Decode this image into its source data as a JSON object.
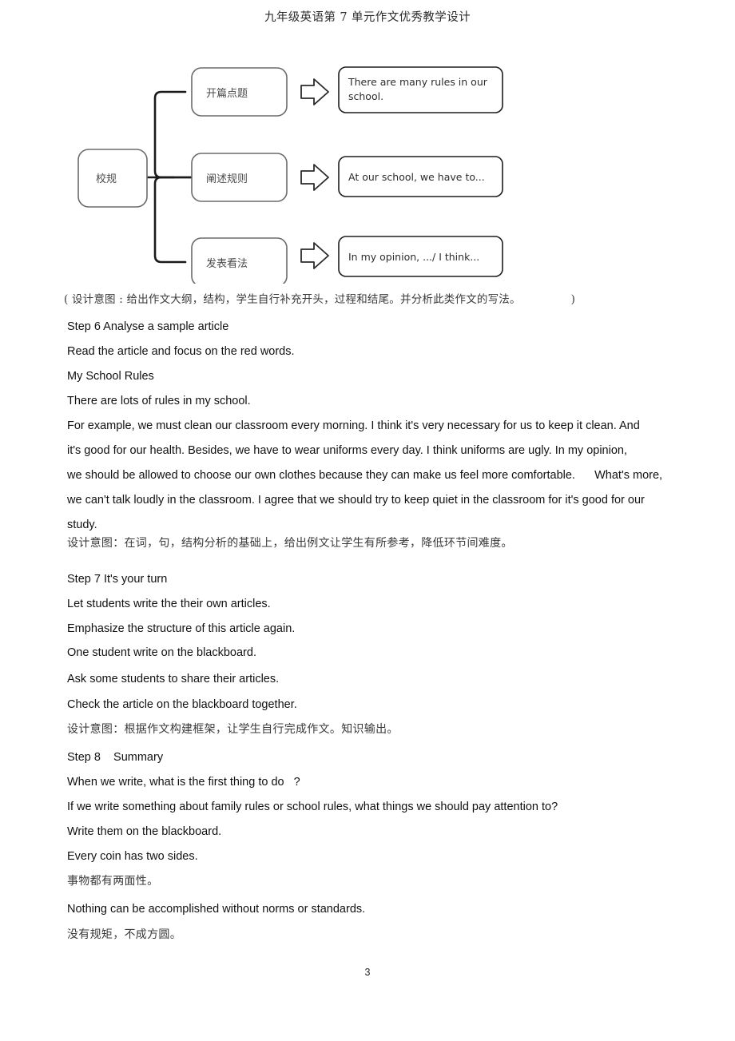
{
  "header": {
    "title": "九年级英语第 7 单元作文优秀教学设计"
  },
  "diagram": {
    "root_node": "校规",
    "branches": [
      {
        "stage": "开篇点题",
        "phrase_line1": "There are many rules in our",
        "phrase_line2": "school."
      },
      {
        "stage": "阐述规则",
        "phrase_line1": "At our school, we have to...",
        "phrase_line2": ""
      },
      {
        "stage": "发表看法",
        "phrase_line1": "In my opinion, .../ I think...",
        "phrase_line2": ""
      }
    ],
    "arrow_icon": "right-block-arrow"
  },
  "diagram_caption": "( 设计意图 : 给出作文大纲，结构，学生自行补充开头，过程和结尾。并分析此类作文的写法。              )",
  "step6": {
    "heading": "Step 6 Analyse a sample article",
    "instruction": "Read the article and focus on the red words.",
    "article_title": "My School Rules",
    "article_lead": "There are lots of rules in my school.",
    "article_lines": [
      "For example, we must clean our classroom every morning. I think it's very necessary for us to keep it clean. And",
      "it's good for our health. Besides, we have to wear uniforms every day. I think uniforms are ugly. In my opinion,",
      "we should be allowed to choose our own clothes because they can make us feel more comfortable.      What's more,",
      "we can't talk loudly in the classroom. I agree that we should try to keep quiet in the classroom for it's good for our",
      "study."
    ],
    "intent": "设计意图：在词，句，结构分析的基础上，给出例文让学生有所参考，降低环节间难度。"
  },
  "step7": {
    "heading": "Step 7 It's your turn",
    "lines": [
      "Let students write the their own articles.",
      "Emphasize the structure of this article again.",
      "One student write on the blackboard.",
      "Ask some students to share their articles.",
      "Check the article on the blackboard together."
    ],
    "intent": "设计意图：根据作文构建框架，让学生自行完成作文。知识输出。"
  },
  "step8": {
    "heading": "Step 8    Summary",
    "lines": [
      "When we write, what is the first thing to do   ?",
      "If we write something about family rules or school rules, what things we should pay attention to?",
      "Write them on the blackboard.",
      "Every coin has two sides."
    ],
    "proverb1_cn": "事物都有两面性。",
    "proverb2_en": "Nothing can be accomplished without norms or standards.",
    "proverb2_cn": "没有规矩，不成方圆。"
  },
  "footer": {
    "page_number": "3"
  }
}
